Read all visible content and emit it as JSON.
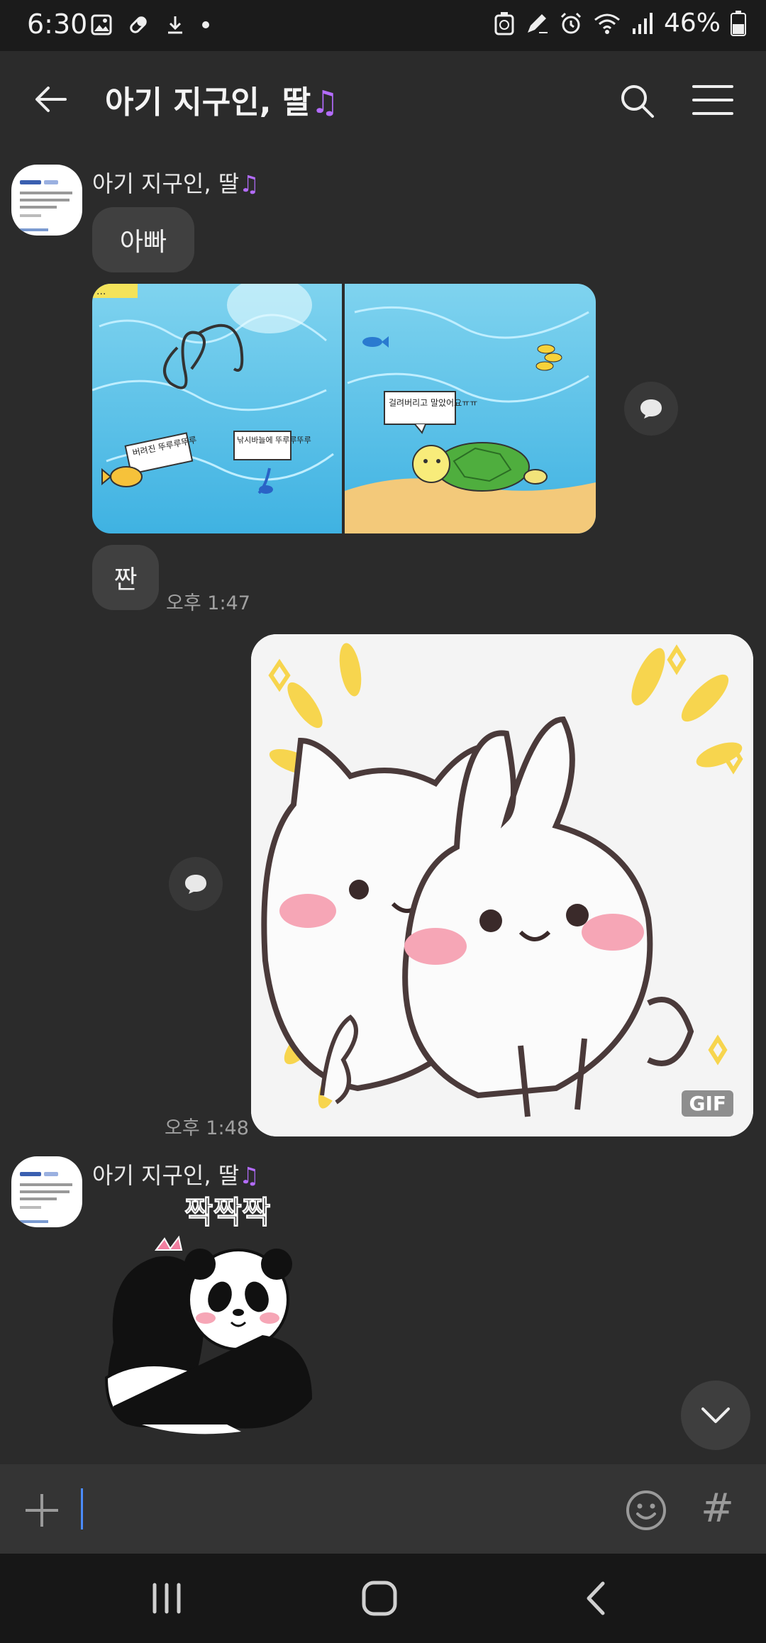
{
  "status_bar": {
    "time": "6:30",
    "battery_percent": "46%",
    "left_icons": [
      "gallery-icon",
      "pill-icon",
      "download-icon",
      "dot-icon"
    ],
    "right_icons": [
      "recycle-icon",
      "pen-icon",
      "alarm-icon",
      "wifi-icon",
      "signal-icon",
      "battery-icon"
    ]
  },
  "header": {
    "title": "아기 지구인, 딸",
    "title_suffix_glyph": "♫"
  },
  "messages": [
    {
      "sender": "아기 지구인, 딸",
      "sender_suffix": "♫",
      "text": "아빠"
    },
    {
      "type": "image-pair",
      "left_caption": "버려진 뚜루루뚜루",
      "left_caption2": "낚시바늘에 뚜루루뚜루",
      "right_caption": "걸려버리고 말았어요ㅠㅠ"
    },
    {
      "text": "짠",
      "time": "오후 1:47"
    },
    {
      "type": "gif",
      "badge": "GIF",
      "time": "오후 1:48"
    },
    {
      "sender": "아기 지구인, 딸",
      "sender_suffix": "♫",
      "sticker_caption": "짝짝짝"
    }
  ],
  "input": {
    "placeholder": "",
    "hash_label": "#"
  },
  "colors": {
    "background": "#2b2b2b",
    "bubble": "#404040",
    "caret": "#4b8cff",
    "note": "#b46cff"
  }
}
